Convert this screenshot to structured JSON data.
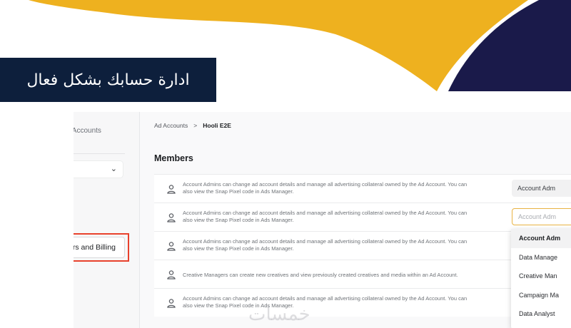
{
  "banner": {
    "title": "ادارة حسابك بشكل فعال",
    "colors": {
      "yellow": "#eeb11f",
      "navy": "#1a1a4a",
      "label_bg": "#0d1f3c"
    }
  },
  "sidebar": {
    "accounts_label": "e Accounts",
    "select_chevron": "⌄",
    "billing_label": "ers and Billing",
    "highlight_color": "#e8412c"
  },
  "breadcrumb": {
    "parent": "Ad Accounts",
    "separator": ">",
    "current": "Hooli E2E"
  },
  "page": {
    "title": "Members"
  },
  "members": [
    {
      "desc_line1": "Account Admins can change ad account details and manage all advertising collateral owned by the Ad Account. You can",
      "desc_line2": "also view the Snap Pixel code in Ads Manager.",
      "role": "Account Adm"
    },
    {
      "desc_line1": "Account Admins can change ad account details and manage all advertising collateral owned by the Ad Account. You can",
      "desc_line2": "also view the Snap Pixel code in Ads Manager.",
      "role": "Account Adm"
    },
    {
      "desc_line1": "Account Admins can change ad account details and manage all advertising collateral owned by the Ad Account. You can",
      "desc_line2": "also view the Snap Pixel code in Ads Manager."
    },
    {
      "desc_line1": "Creative Managers can create new creatives and view previously created creatives and media within an Ad Account."
    },
    {
      "desc_line1": "Account Admins can change ad account details and manage all advertising collateral owned by the Ad Account. You can",
      "desc_line2": "also view the Snap Pixel code in Ads Manager."
    }
  ],
  "role_options": [
    "Account Adm",
    "Data Manage",
    "Creative Man",
    "Campaign Ma",
    "Data Analyst"
  ],
  "selected_role": "Account Adm",
  "watermark": "خمسات"
}
